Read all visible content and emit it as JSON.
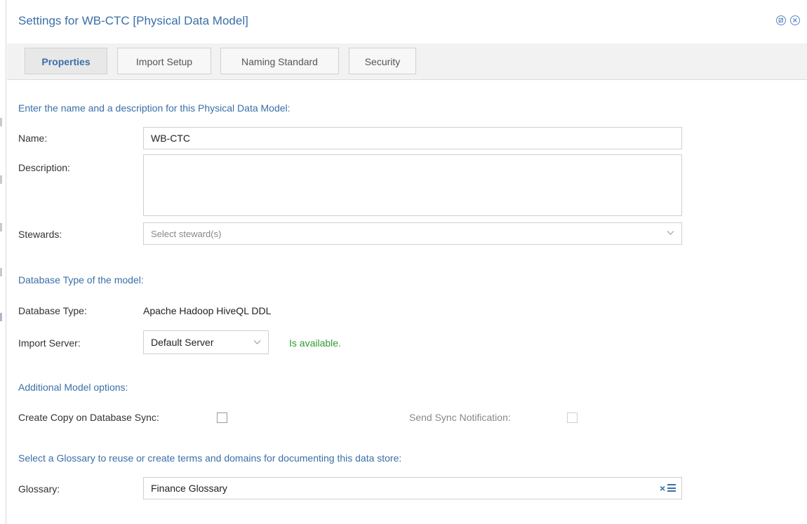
{
  "dialog": {
    "title": "Settings for WB-CTC [Physical Data Model]",
    "title_icons": [
      "restore-icon",
      "close-icon"
    ]
  },
  "tabs": [
    {
      "label": "Properties",
      "active": true
    },
    {
      "label": "Import Setup",
      "active": false
    },
    {
      "label": "Naming Standard",
      "active": false
    },
    {
      "label": "Security",
      "active": false
    }
  ],
  "properties": {
    "intro_heading": "Enter the name and a description for this Physical Data Model:",
    "name": {
      "label": "Name:",
      "value": "WB-CTC"
    },
    "description": {
      "label": "Description:",
      "value": ""
    },
    "stewards": {
      "label": "Stewards:",
      "placeholder": "Select steward(s)"
    }
  },
  "database": {
    "heading": "Database Type of the model:",
    "type_label": "Database Type:",
    "type_value": "Apache Hadoop HiveQL DDL",
    "server_label": "Import Server:",
    "server_value": "Default Server",
    "server_status": "Is available."
  },
  "additional": {
    "heading": "Additional Model options:",
    "create_copy_label": "Create Copy on Database Sync:",
    "create_copy_checked": false,
    "send_sync_label": "Send Sync Notification:",
    "send_sync_checked": false,
    "send_sync_disabled": true
  },
  "glossary": {
    "heading": "Select a Glossary to reuse or create terms and domains for documenting this data store:",
    "label": "Glossary:",
    "value": "Finance Glossary",
    "clear_symbol": "×"
  },
  "colors": {
    "accent": "#3a6fa8",
    "status_ok": "#2e9a2e",
    "tabbar_bg": "#f2f2f2"
  }
}
